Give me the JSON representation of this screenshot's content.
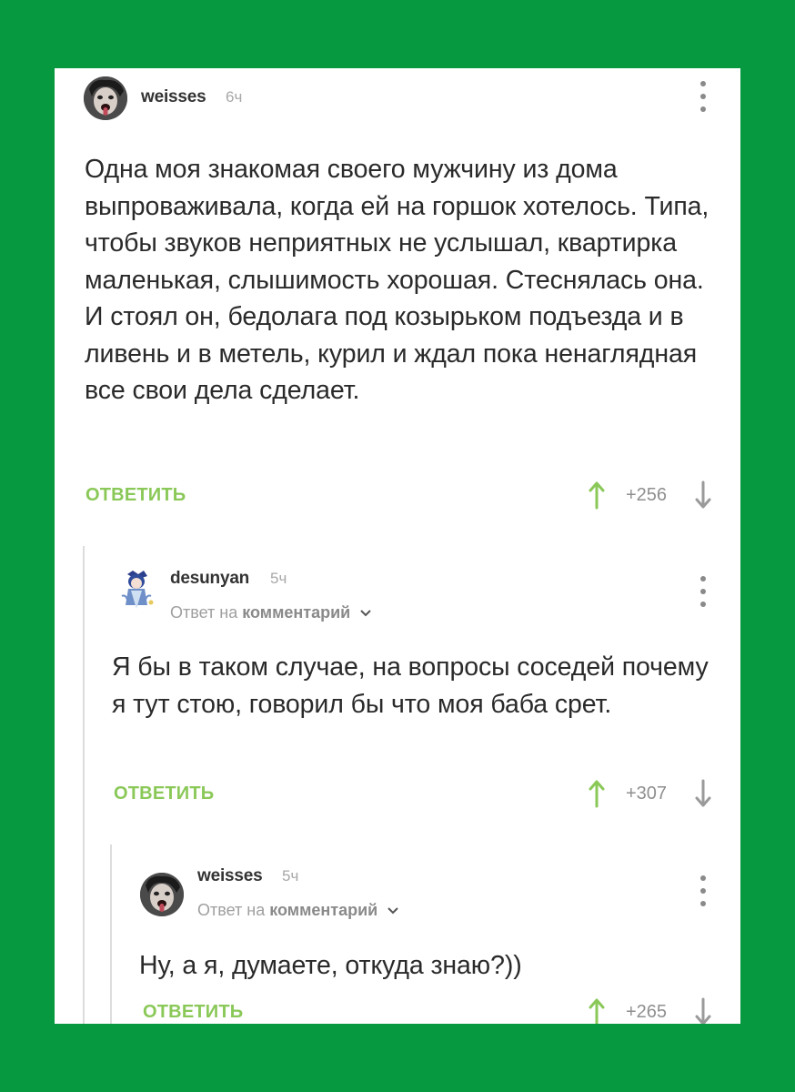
{
  "colors": {
    "frame": "#079940",
    "accent": "#8ac858",
    "text": "#2a2a2a",
    "muted": "#9f9f9f"
  },
  "comments": [
    {
      "username": "weisses",
      "time": "6ч",
      "text": "Одна моя знакомая своего мужчину из дома выпроваживала, когда ей на горшок хотелось. Типа, чтобы звуков неприятных не услышал, квартирка маленькая, слышимость хорошая. Стеснялась она. И стоял он, бедолага под козырьком подъезда и в ливень и в метель, курил и ждал пока ненаглядная все свои дела сделает.",
      "reply_label": "ОТВЕТИТЬ",
      "score": "+256",
      "avatar_icon": "user-avatar-icon"
    },
    {
      "username": "desunyan",
      "time": "5ч",
      "reply_to_prefix": "Ответ на",
      "reply_to_link": "комментарий",
      "text": "Я бы в таком случае, на вопросы соседей почему я тут стою, говорил бы что моя баба срет.",
      "reply_label": "ОТВЕТИТЬ",
      "score": "+307",
      "avatar_icon": "anime-avatar-icon"
    },
    {
      "username": "weisses",
      "time": "5ч",
      "reply_to_prefix": "Ответ на",
      "reply_to_link": "комментарий",
      "text": "Ну, а я, думаете, откуда знаю?))",
      "reply_label": "ОТВЕТИТЬ",
      "score": "+265",
      "avatar_icon": "user-avatar-icon"
    }
  ]
}
